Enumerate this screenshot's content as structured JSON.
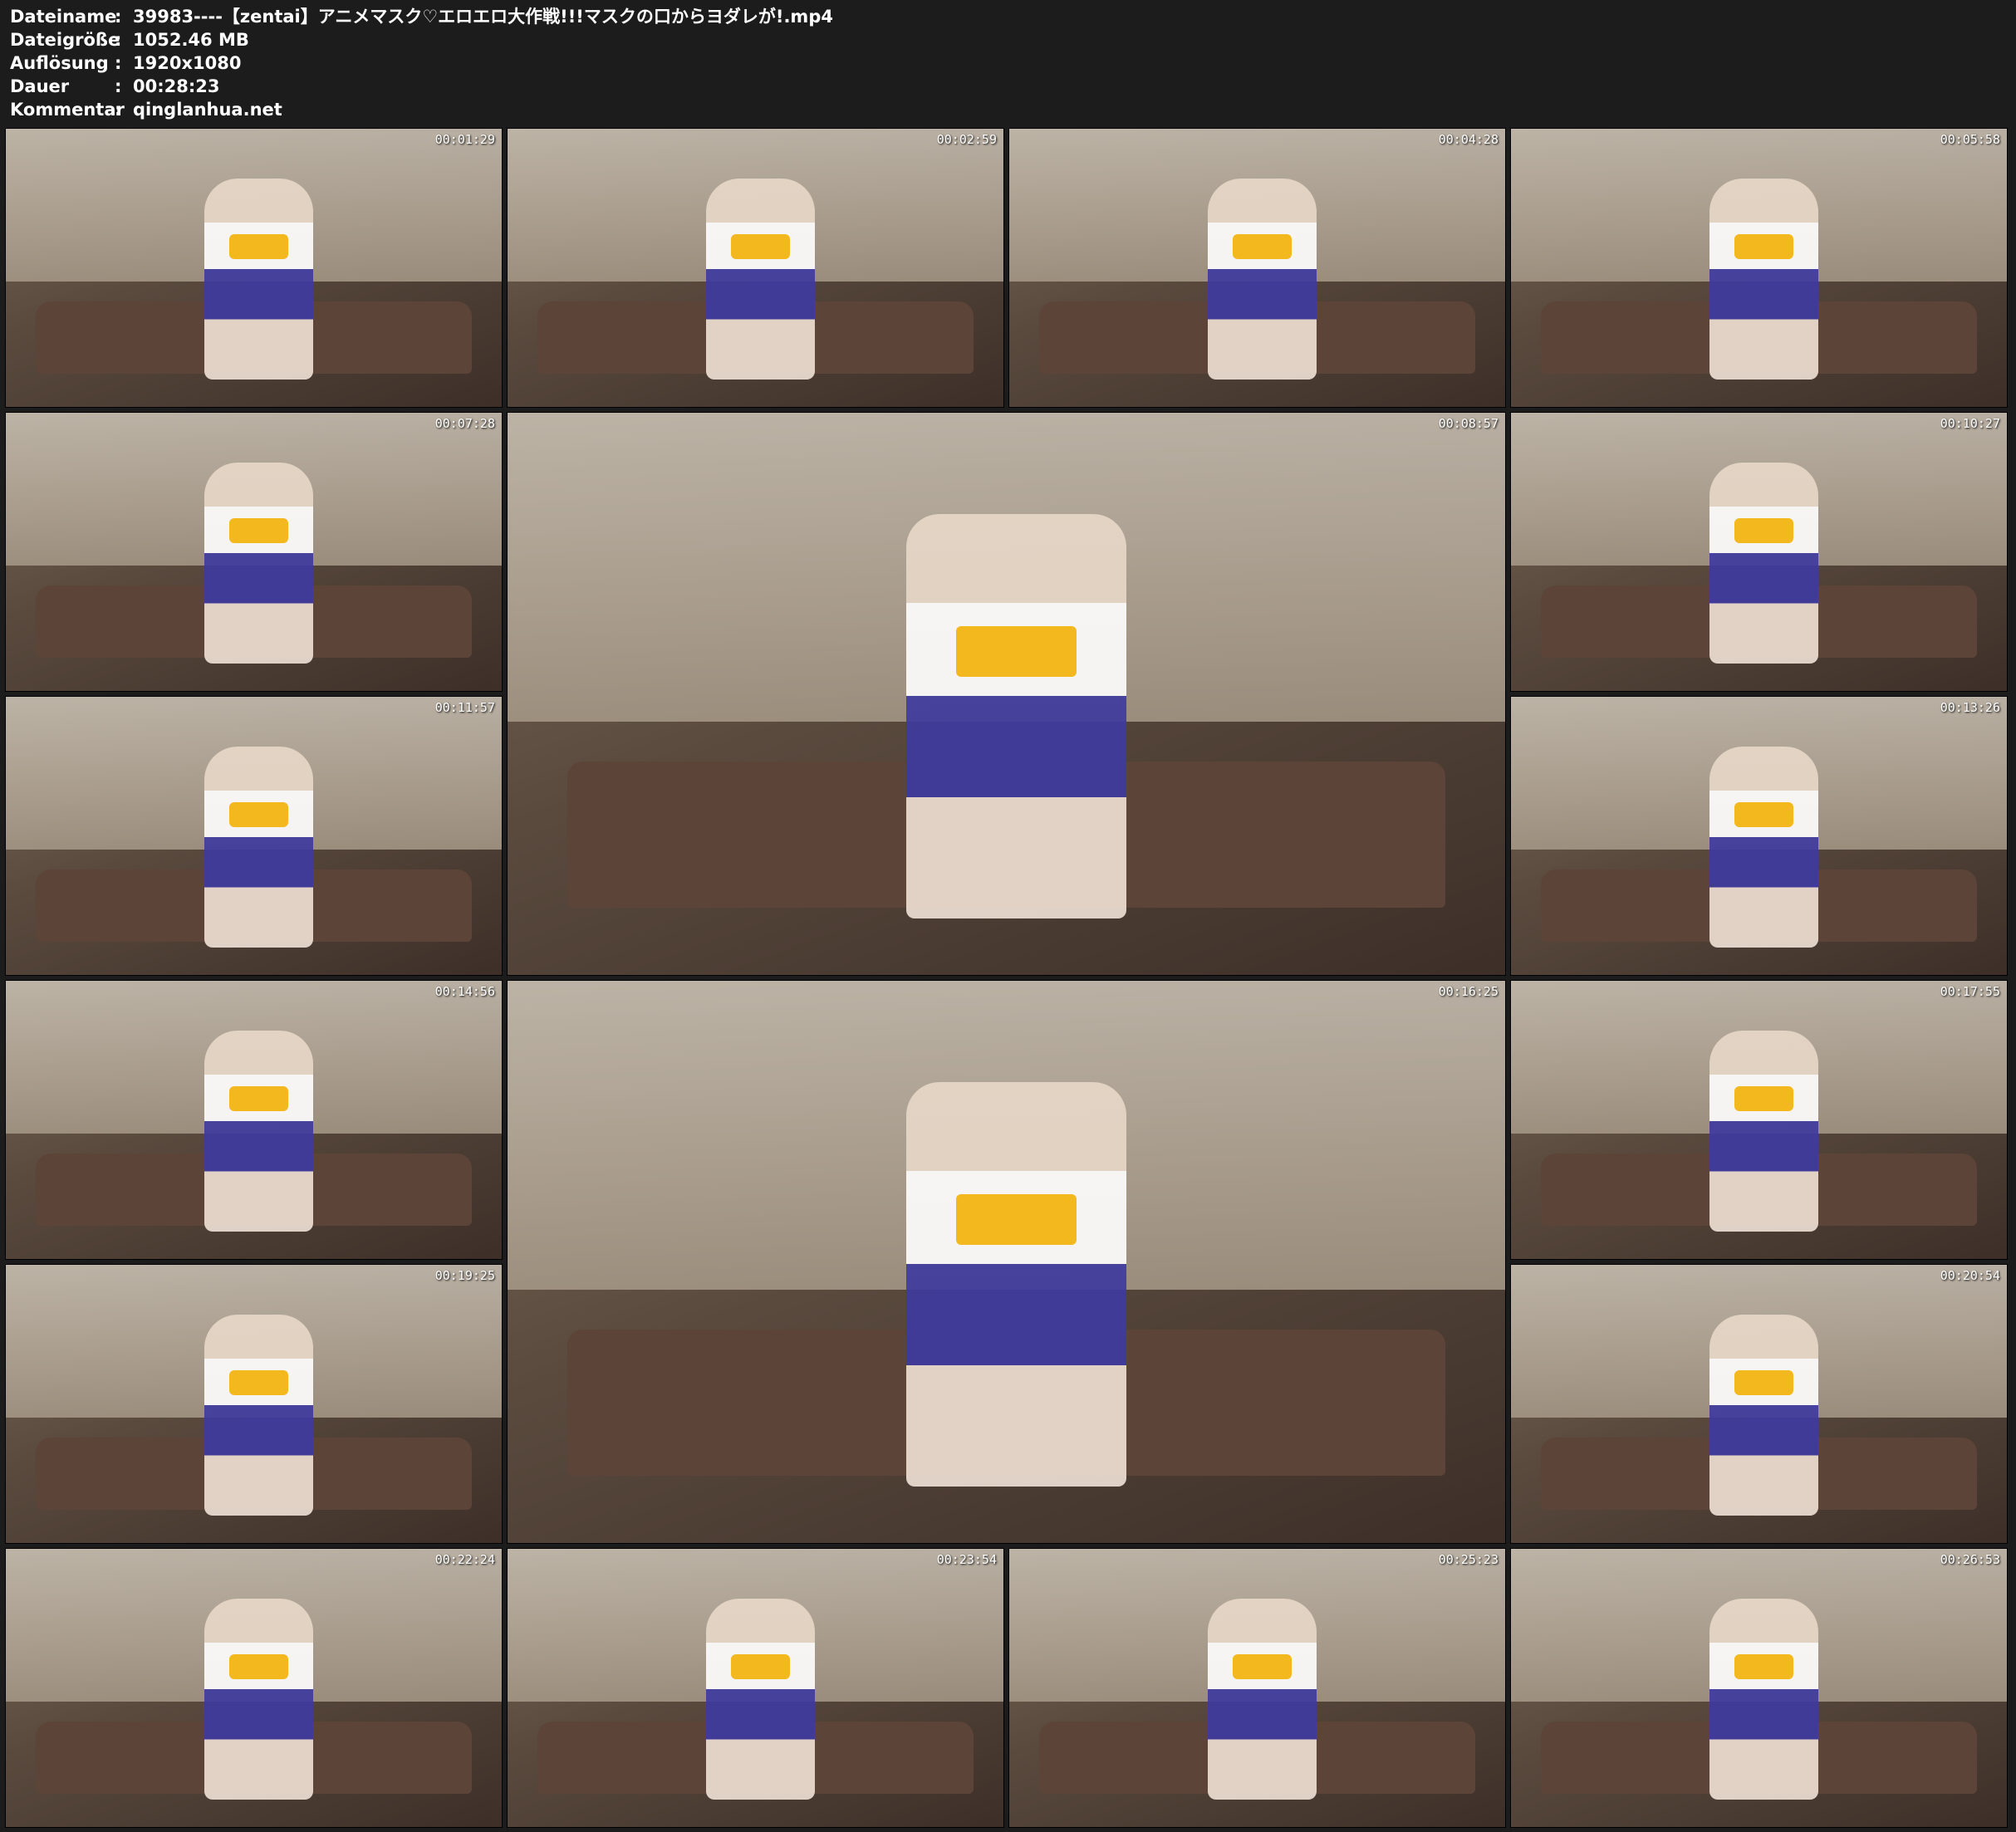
{
  "meta": {
    "rows": [
      {
        "key": "Dateiname",
        "sep": ":",
        "value": "39983----【zentai】アニメマスク♡エロエロ大作戦!!!マスクの口からヨダレが!.mp4"
      },
      {
        "key": "Dateigröße",
        "sep": ":",
        "value": "1052.46 MB"
      },
      {
        "key": "Auflösung",
        "sep": ":",
        "value": "1920x1080"
      },
      {
        "key": "Dauer",
        "sep": ":",
        "value": "00:28:23"
      },
      {
        "key": "Kommentar",
        "sep": ":",
        "value": "qinglanhua.net"
      }
    ]
  },
  "thumbnails": [
    {
      "time": "00:01:29"
    },
    {
      "time": "00:02:59"
    },
    {
      "time": "00:04:28"
    },
    {
      "time": "00:05:58"
    },
    {
      "time": "00:07:28"
    },
    {
      "time": "00:08:57"
    },
    {
      "time": "00:10:27"
    },
    {
      "time": "00:11:57"
    },
    {
      "time": "00:13:26"
    },
    {
      "time": "00:14:56"
    },
    {
      "time": "00:16:25"
    },
    {
      "time": "00:17:55"
    },
    {
      "time": "00:19:25"
    },
    {
      "time": "00:20:54"
    },
    {
      "time": "00:22:24"
    },
    {
      "time": "00:23:54"
    },
    {
      "time": "00:25:23"
    },
    {
      "time": "00:26:53"
    }
  ]
}
